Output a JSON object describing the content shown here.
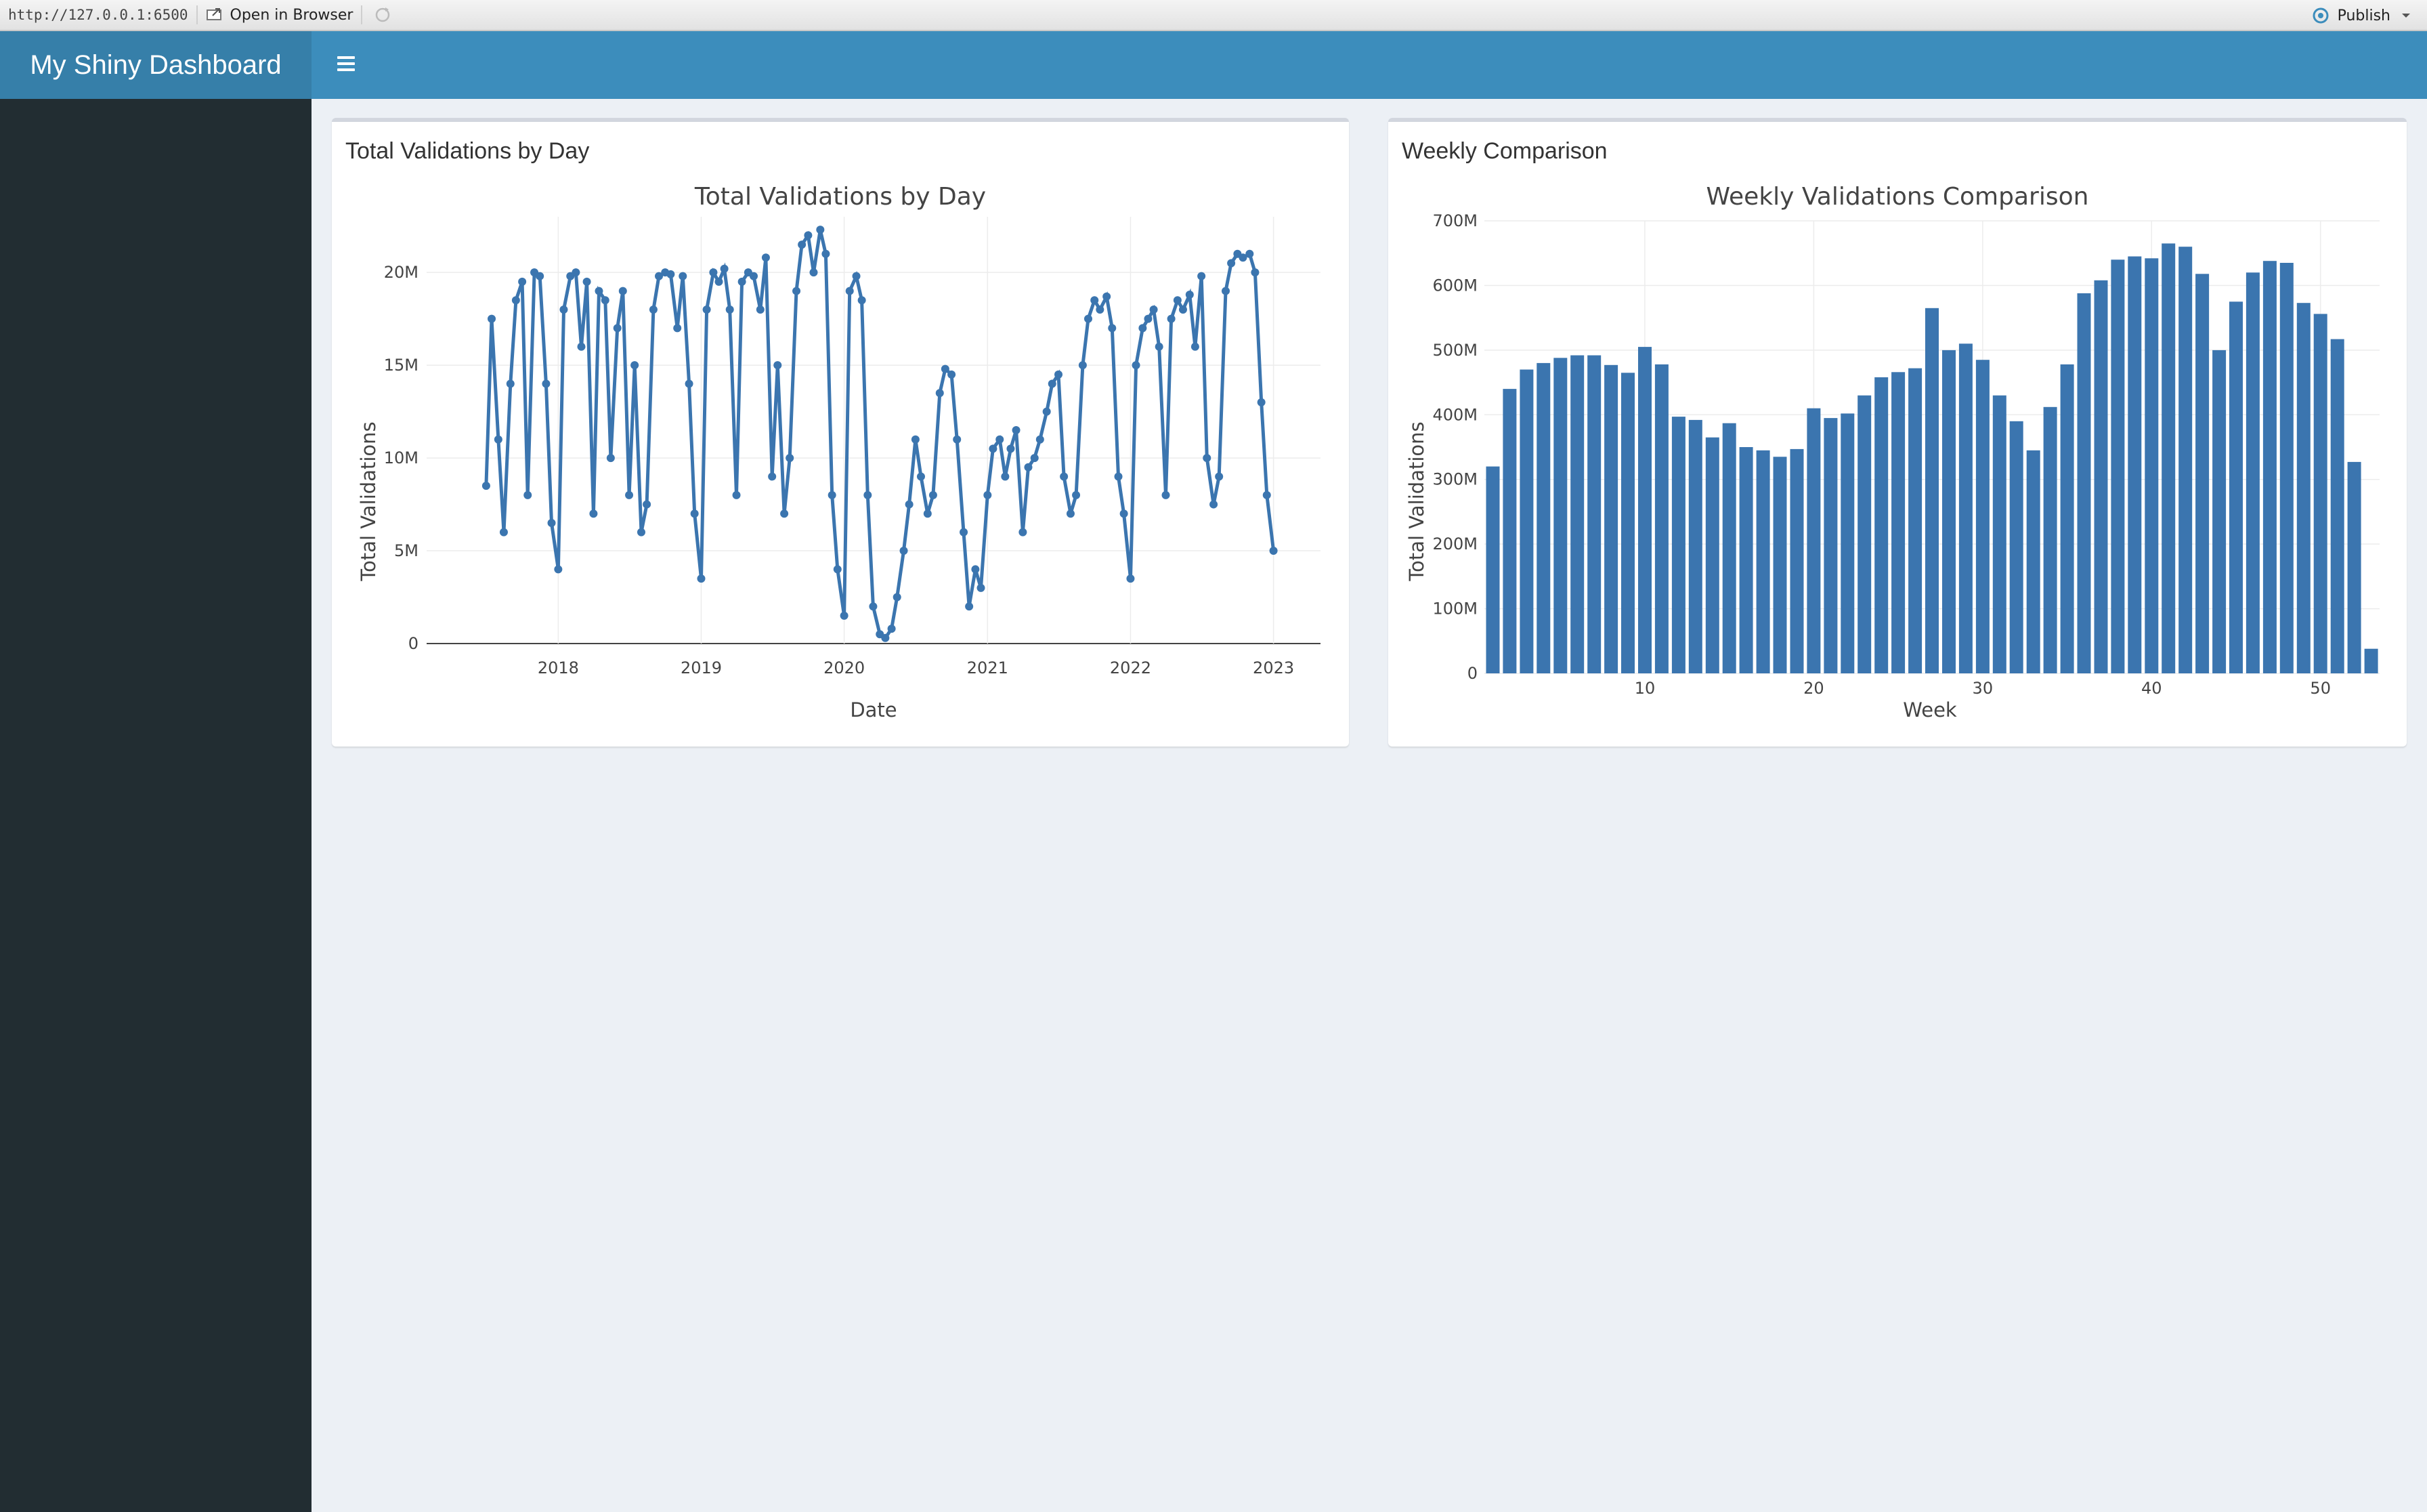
{
  "viewer": {
    "url": "http://127.0.0.1:6500",
    "open_in_browser": "Open in Browser",
    "publish": "Publish"
  },
  "header": {
    "title": "My Shiny Dashboard"
  },
  "colors": {
    "series": "#3b75af",
    "header": "#3c8dbc",
    "logo": "#367fa9",
    "sidebar": "#222d32"
  },
  "boxes": {
    "left_title": "Total Validations by Day",
    "right_title": "Weekly Comparison"
  },
  "chart_data": [
    {
      "type": "line",
      "title": "Total Validations by Day",
      "xlabel": "Date",
      "ylabel": "Total Validations",
      "x_ticks": [
        "2018",
        "2019",
        "2020",
        "2021",
        "2022",
        "2023"
      ],
      "y_ticks": [
        "0",
        "5M",
        "10M",
        "15M",
        "20M"
      ],
      "ylim": [
        0,
        23000000
      ],
      "xlim": [
        "2017-01-30",
        "2023-05-01"
      ],
      "series": [
        {
          "markers": true,
          "points": [
            [
              "2017-07-01",
              8500000
            ],
            [
              "2017-07-15",
              17500000
            ],
            [
              "2017-08-01",
              11000000
            ],
            [
              "2017-08-15",
              6000000
            ],
            [
              "2017-09-01",
              14000000
            ],
            [
              "2017-09-15",
              18500000
            ],
            [
              "2017-10-01",
              19500000
            ],
            [
              "2017-10-15",
              8000000
            ],
            [
              "2017-11-01",
              20000000
            ],
            [
              "2017-11-15",
              19800000
            ],
            [
              "2017-12-01",
              14000000
            ],
            [
              "2017-12-15",
              6500000
            ],
            [
              "2018-01-01",
              4000000
            ],
            [
              "2018-01-15",
              18000000
            ],
            [
              "2018-02-01",
              19800000
            ],
            [
              "2018-02-15",
              20000000
            ],
            [
              "2018-03-01",
              16000000
            ],
            [
              "2018-03-15",
              19500000
            ],
            [
              "2018-04-01",
              7000000
            ],
            [
              "2018-04-15",
              19000000
            ],
            [
              "2018-05-01",
              18500000
            ],
            [
              "2018-05-15",
              10000000
            ],
            [
              "2018-06-01",
              17000000
            ],
            [
              "2018-06-15",
              19000000
            ],
            [
              "2018-07-01",
              8000000
            ],
            [
              "2018-07-15",
              15000000
            ],
            [
              "2018-08-01",
              6000000
            ],
            [
              "2018-08-15",
              7500000
            ],
            [
              "2018-09-01",
              18000000
            ],
            [
              "2018-09-15",
              19800000
            ],
            [
              "2018-10-01",
              20000000
            ],
            [
              "2018-10-15",
              19900000
            ],
            [
              "2018-11-01",
              17000000
            ],
            [
              "2018-11-15",
              19800000
            ],
            [
              "2018-12-01",
              14000000
            ],
            [
              "2018-12-15",
              7000000
            ],
            [
              "2019-01-01",
              3500000
            ],
            [
              "2019-01-15",
              18000000
            ],
            [
              "2019-02-01",
              20000000
            ],
            [
              "2019-02-15",
              19500000
            ],
            [
              "2019-03-01",
              20200000
            ],
            [
              "2019-03-15",
              18000000
            ],
            [
              "2019-04-01",
              8000000
            ],
            [
              "2019-04-15",
              19500000
            ],
            [
              "2019-05-01",
              20000000
            ],
            [
              "2019-05-15",
              19800000
            ],
            [
              "2019-06-01",
              18000000
            ],
            [
              "2019-06-15",
              20800000
            ],
            [
              "2019-07-01",
              9000000
            ],
            [
              "2019-07-15",
              15000000
            ],
            [
              "2019-08-01",
              7000000
            ],
            [
              "2019-08-15",
              10000000
            ],
            [
              "2019-09-01",
              19000000
            ],
            [
              "2019-09-15",
              21500000
            ],
            [
              "2019-10-01",
              22000000
            ],
            [
              "2019-10-15",
              20000000
            ],
            [
              "2019-11-01",
              22300000
            ],
            [
              "2019-11-15",
              21000000
            ],
            [
              "2019-12-01",
              8000000
            ],
            [
              "2019-12-15",
              4000000
            ],
            [
              "2020-01-01",
              1500000
            ],
            [
              "2020-01-15",
              19000000
            ],
            [
              "2020-02-01",
              19800000
            ],
            [
              "2020-02-15",
              18500000
            ],
            [
              "2020-03-01",
              8000000
            ],
            [
              "2020-03-15",
              2000000
            ],
            [
              "2020-04-01",
              500000
            ],
            [
              "2020-04-15",
              300000
            ],
            [
              "2020-05-01",
              800000
            ],
            [
              "2020-05-15",
              2500000
            ],
            [
              "2020-06-01",
              5000000
            ],
            [
              "2020-06-15",
              7500000
            ],
            [
              "2020-07-01",
              11000000
            ],
            [
              "2020-07-15",
              9000000
            ],
            [
              "2020-08-01",
              7000000
            ],
            [
              "2020-08-15",
              8000000
            ],
            [
              "2020-09-01",
              13500000
            ],
            [
              "2020-09-15",
              14800000
            ],
            [
              "2020-10-01",
              14500000
            ],
            [
              "2020-10-15",
              11000000
            ],
            [
              "2020-11-01",
              6000000
            ],
            [
              "2020-11-15",
              2000000
            ],
            [
              "2020-12-01",
              4000000
            ],
            [
              "2020-12-15",
              3000000
            ],
            [
              "2021-01-01",
              8000000
            ],
            [
              "2021-01-15",
              10500000
            ],
            [
              "2021-02-01",
              11000000
            ],
            [
              "2021-02-15",
              9000000
            ],
            [
              "2021-03-01",
              10500000
            ],
            [
              "2021-03-15",
              11500000
            ],
            [
              "2021-04-01",
              6000000
            ],
            [
              "2021-04-15",
              9500000
            ],
            [
              "2021-05-01",
              10000000
            ],
            [
              "2021-05-15",
              11000000
            ],
            [
              "2021-06-01",
              12500000
            ],
            [
              "2021-06-15",
              14000000
            ],
            [
              "2021-07-01",
              14500000
            ],
            [
              "2021-07-15",
              9000000
            ],
            [
              "2021-08-01",
              7000000
            ],
            [
              "2021-08-15",
              8000000
            ],
            [
              "2021-09-01",
              15000000
            ],
            [
              "2021-09-15",
              17500000
            ],
            [
              "2021-10-01",
              18500000
            ],
            [
              "2021-10-15",
              18000000
            ],
            [
              "2021-11-01",
              18700000
            ],
            [
              "2021-11-15",
              17000000
            ],
            [
              "2021-12-01",
              9000000
            ],
            [
              "2021-12-15",
              7000000
            ],
            [
              "2022-01-01",
              3500000
            ],
            [
              "2022-01-15",
              15000000
            ],
            [
              "2022-02-01",
              17000000
            ],
            [
              "2022-02-15",
              17500000
            ],
            [
              "2022-03-01",
              18000000
            ],
            [
              "2022-03-15",
              16000000
            ],
            [
              "2022-04-01",
              8000000
            ],
            [
              "2022-04-15",
              17500000
            ],
            [
              "2022-05-01",
              18500000
            ],
            [
              "2022-05-15",
              18000000
            ],
            [
              "2022-06-01",
              18800000
            ],
            [
              "2022-06-15",
              16000000
            ],
            [
              "2022-07-01",
              19800000
            ],
            [
              "2022-07-15",
              10000000
            ],
            [
              "2022-08-01",
              7500000
            ],
            [
              "2022-08-15",
              9000000
            ],
            [
              "2022-09-01",
              19000000
            ],
            [
              "2022-09-15",
              20500000
            ],
            [
              "2022-10-01",
              21000000
            ],
            [
              "2022-10-15",
              20800000
            ],
            [
              "2022-11-01",
              21000000
            ],
            [
              "2022-11-15",
              20000000
            ],
            [
              "2022-12-01",
              13000000
            ],
            [
              "2022-12-15",
              8000000
            ],
            [
              "2023-01-01",
              5000000
            ]
          ]
        }
      ]
    },
    {
      "type": "bar",
      "title": "Weekly Validations Comparison",
      "xlabel": "Week",
      "ylabel": "Total Validations",
      "x_ticks": [
        "10",
        "20",
        "30",
        "40",
        "50"
      ],
      "y_ticks": [
        "0",
        "100M",
        "200M",
        "300M",
        "400M",
        "500M",
        "600M",
        "700M"
      ],
      "ylim": [
        0,
        700000000
      ],
      "xlim": [
        0.5,
        53.5
      ],
      "categories": [
        1,
        2,
        3,
        4,
        5,
        6,
        7,
        8,
        9,
        10,
        11,
        12,
        13,
        14,
        15,
        16,
        17,
        18,
        19,
        20,
        21,
        22,
        23,
        24,
        25,
        26,
        27,
        28,
        29,
        30,
        31,
        32,
        33,
        34,
        35,
        36,
        37,
        38,
        39,
        40,
        41,
        42,
        43,
        44,
        45,
        46,
        47,
        48,
        49,
        50,
        51,
        52,
        53
      ],
      "values": [
        320000000,
        440000000,
        470000000,
        480000000,
        488000000,
        492000000,
        492000000,
        477000000,
        465000000,
        505000000,
        478000000,
        397000000,
        392000000,
        365000000,
        387000000,
        350000000,
        345000000,
        335000000,
        347000000,
        410000000,
        395000000,
        402000000,
        430000000,
        458000000,
        466000000,
        472000000,
        565000000,
        500000000,
        510000000,
        485000000,
        430000000,
        390000000,
        345000000,
        412000000,
        478000000,
        588000000,
        608000000,
        640000000,
        645000000,
        642000000,
        665000000,
        660000000,
        618000000,
        500000000,
        575000000,
        620000000,
        638000000,
        635000000,
        573000000,
        556000000,
        517000000,
        327000000,
        38000000
      ]
    }
  ]
}
